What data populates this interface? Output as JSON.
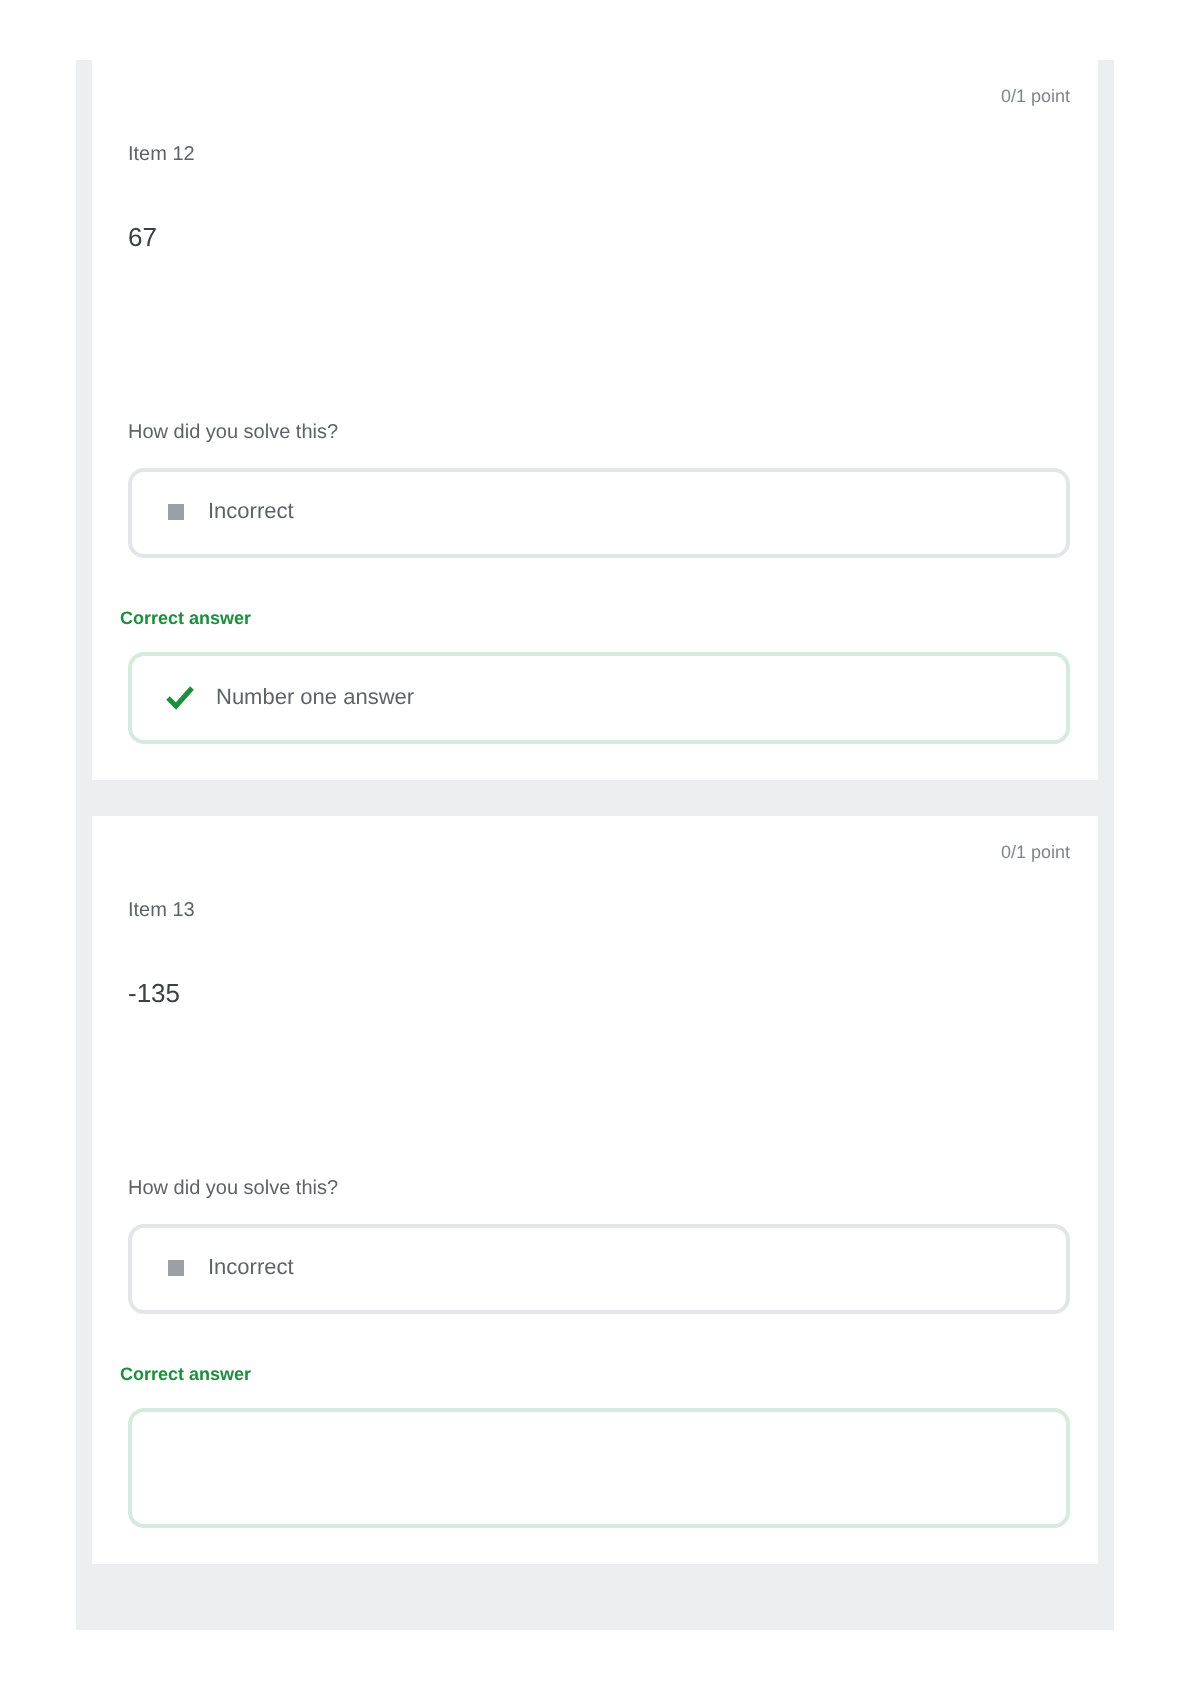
{
  "questions": [
    {
      "points": "0/1 point",
      "label": "Item 12",
      "value": "67",
      "prompt": "How did you solve this?",
      "response": {
        "kind": "box",
        "text": "Incorrect"
      },
      "answer_label": "Correct answer",
      "answer": {
        "kind": "check",
        "text": "Number one answer"
      }
    },
    {
      "points": "0/1 point",
      "label": "Item 13",
      "value": "-135",
      "prompt": "How did you solve this?",
      "response": {
        "kind": "box",
        "text": "Incorrect"
      },
      "answer_label": "Correct answer",
      "answer": {
        "kind": "empty"
      }
    }
  ]
}
